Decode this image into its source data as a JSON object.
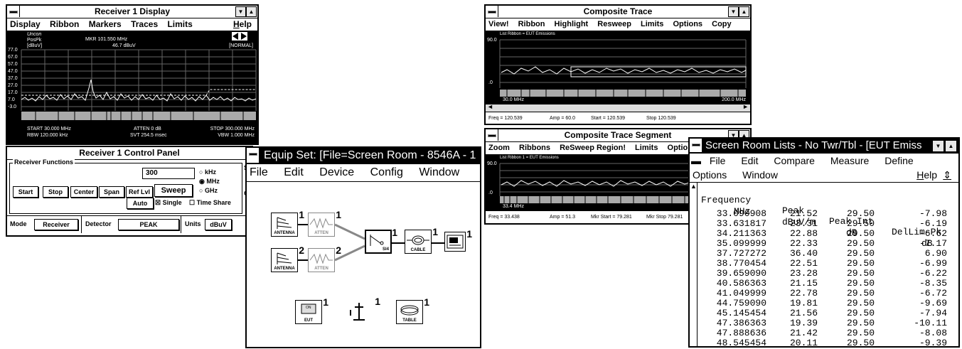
{
  "w1": {
    "title": "Receiver 1 Display",
    "menu": [
      "Display",
      "Ribbon",
      "Markers",
      "Traces",
      "Limits",
      "Help"
    ],
    "top_left": [
      "Uncon",
      "PosPk",
      "[dBuV]"
    ],
    "mkr_line1": "MKR  101.550 MHz",
    "mkr_line2": "46.7 dBuV",
    "normal": "[NORMAL]",
    "yticks": [
      "77.0",
      "67.0",
      "57.0",
      "47.0",
      "37.0",
      "27.0",
      "17.0",
      "7.0",
      "-3.0"
    ],
    "start": "START 30.000 MHz",
    "rbw": "RBW 120.000 kHz",
    "atten": "ATTEN 0 dB",
    "svt": "SVT 254.5 msec",
    "stop": "STOP 300.000 MHz",
    "vbw": "VBW 1.000 MHz"
  },
  "w2": {
    "title": "Receiver 1 Control Panel",
    "group": "Receiver Functions",
    "freq_value": "300",
    "units": [
      "kHz",
      "MHz",
      "GHz"
    ],
    "buttons": [
      "Start",
      "Stop",
      "Center",
      "Span",
      "Ref Lvl"
    ],
    "sweep": "Sweep",
    "auto": "Auto",
    "single": "Single",
    "timeshare": "Time Share",
    "mode_label": "Mode",
    "mode_value": "Receiver",
    "det_label": "Detector",
    "det_value": "PEAK",
    "units_label": "Units",
    "units_value": "dBuV",
    "side_s": "S",
    "side_c": "C"
  },
  "w3": {
    "title": "Equip Set: [File=Screen Room - 8546A - 1",
    "menu": [
      "File",
      "Edit",
      "Device",
      "Config",
      "Window"
    ],
    "icons": {
      "ant1": "ANTENNA",
      "ant2": "ANTENNA",
      "att1": "ATTEN",
      "att2": "ATTEN",
      "sw": "Sl4",
      "cable": "CABLE",
      "eut": "EUT",
      "table": "TABLE",
      "eut_screen": "ON",
      "n1": "1",
      "n2": "2"
    }
  },
  "w4": {
    "title": "Composite Trace",
    "menu": [
      "View!",
      "Ribbon",
      "Highlight",
      "Resweep",
      "Limits",
      "Options",
      "Copy"
    ],
    "ribbon": "List Ribbon = EUT Emissions",
    "y_top": "90.0",
    "y_bot": ".0",
    "x_left": "30.0 MHz",
    "x_right": "200.0 MHz",
    "status": [
      "Freq = 120.539",
      "Amp = 60.0",
      "Start = 120.539",
      "Stop 120.539"
    ]
  },
  "w5": {
    "title": "Composite Trace Segment",
    "menu": [
      "Zoom",
      "Ribbons",
      "ReSweep Region!",
      "Limits",
      "Options"
    ],
    "ribbon": "List Ribbon 1 = EUT Emissions",
    "y_top": "90.0",
    "y_bot": ".0",
    "x_left": "33.4 MHz",
    "status": [
      "Freq = 33.438",
      "Amp = 51.3",
      "Mkr Start = 79.281",
      "Mkr Stop 79.281"
    ]
  },
  "w6": {
    "title": "Screen Room Lists - No Twr/Tbl - [EUT Emiss",
    "menu1": [
      "File",
      "Edit",
      "Compare",
      "Measure",
      "Define"
    ],
    "menu2": [
      "Options",
      "Window"
    ],
    "help": "Help",
    "headers": [
      "Frequency",
      "Peak",
      "Peak Int",
      "DelLim-Pk"
    ],
    "units": [
      "MHz",
      "dBuV/m",
      "dB",
      "dB"
    ],
    "rows": [
      [
        "33.090908",
        "21.52",
        "29.50",
        "-7.98"
      ],
      [
        "33.631817",
        "23.31",
        "29.50",
        "-6.19"
      ],
      [
        "34.211363",
        "22.88",
        "29.50",
        "-6.62"
      ],
      [
        "35.099999",
        "22.33",
        "29.50",
        "-7.17"
      ],
      [
        "37.727272",
        "36.40",
        "29.50",
        "6.90"
      ],
      [
        "38.770454",
        "22.51",
        "29.50",
        "-6.99"
      ],
      [
        "39.659090",
        "23.28",
        "29.50",
        "-6.22"
      ],
      [
        "40.586363",
        "21.15",
        "29.50",
        "-8.35"
      ],
      [
        "41.049999",
        "22.78",
        "29.50",
        "-6.72"
      ],
      [
        "44.759090",
        "19.81",
        "29.50",
        "-9.69"
      ],
      [
        "45.145454",
        "21.56",
        "29.50",
        "-7.94"
      ],
      [
        "47.386363",
        "19.39",
        "29.50",
        "-10.11"
      ],
      [
        "47.888636",
        "21.42",
        "29.50",
        "-8.08"
      ],
      [
        "48.545454",
        "20.11",
        "29.50",
        "-9.39"
      ]
    ]
  }
}
